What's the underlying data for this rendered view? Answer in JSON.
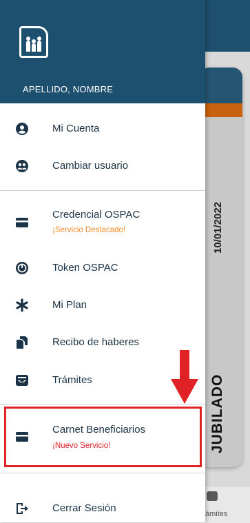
{
  "user": {
    "name": "APELLIDO, NOMBRE"
  },
  "menu": [
    {
      "label": "Mi Cuenta",
      "icon": "account-circle-icon"
    },
    {
      "label": "Cambiar usuario",
      "icon": "switch-user-icon"
    },
    {
      "label": "Credencial OSPAC",
      "sublabel": "¡Servicio Destacado!",
      "sublabel_color": "#f28c28",
      "icon": "credit-card-icon"
    },
    {
      "label": "Token OSPAC",
      "icon": "token-icon"
    },
    {
      "label": "Mi Plan",
      "icon": "asterisk-icon"
    },
    {
      "label": "Recibo de haberes",
      "icon": "receipts-icon"
    },
    {
      "label": "Trámites",
      "icon": "inbox-tray-icon"
    },
    {
      "label": "Carnet Beneficiarios",
      "sublabel": "¡Nuevo Servicio!",
      "sublabel_color": "#e02227",
      "icon": "credit-card-icon"
    },
    {
      "label": "Cerrar Sesión",
      "icon": "logout-icon"
    }
  ],
  "background": {
    "card_date": "10/01/2022",
    "card_status": "JUBILADO",
    "nav_label": "ámites"
  },
  "colors": {
    "header": "#1d4f6e",
    "text": "#1b3347",
    "accent_orange": "#c9620f",
    "highlight_red": "#e02227"
  }
}
